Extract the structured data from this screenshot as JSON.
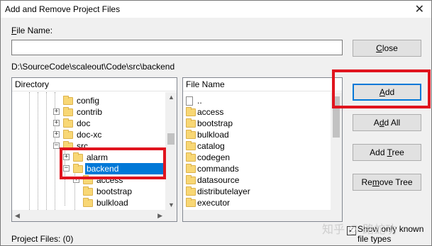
{
  "window": {
    "title": "Add and Remove Project Files",
    "close_glyph": "✕"
  },
  "file_name_label": "File Name:",
  "file_name_value": "",
  "current_path": "D:\\SourceCode\\scaleout\\Code\\src\\backend",
  "directory": {
    "header": "Directory",
    "items": [
      {
        "label": "config",
        "expander": ""
      },
      {
        "label": "contrib",
        "expander": "+"
      },
      {
        "label": "doc",
        "expander": "+"
      },
      {
        "label": "doc-xc",
        "expander": "+"
      },
      {
        "label": "src",
        "expander": "−"
      },
      {
        "label": "alarm",
        "expander": "+"
      },
      {
        "label": "backend",
        "expander": "−",
        "selected": true
      },
      {
        "label": "access",
        "expander": "+"
      },
      {
        "label": "bootstrap",
        "expander": ""
      },
      {
        "label": "bulkload",
        "expander": ""
      }
    ]
  },
  "files": {
    "header": "File Name",
    "items": [
      "..",
      "access",
      "bootstrap",
      "bulkload",
      "catalog",
      "codegen",
      "commands",
      "datasource",
      "distributelayer",
      "executor"
    ]
  },
  "buttons": {
    "close": {
      "label": "Close",
      "mnemonic": "C"
    },
    "add": {
      "label": "Add",
      "mnemonic": "A"
    },
    "add_all": {
      "label": "Add All",
      "mnemonic": "d"
    },
    "add_tree": {
      "label": "Add Tree",
      "mnemonic": "T"
    },
    "remove_tree": {
      "label": "Remove Tree",
      "mnemonic": "m"
    }
  },
  "project_files_label": "Project Files: (0)",
  "show_only_known": {
    "label_line1": "Show only known",
    "label_line2": "file types",
    "checked": true,
    "check_glyph": "✓"
  },
  "watermark": "知乎 @ 路蛇功",
  "colors": {
    "highlight_red": "#e0141e",
    "selection_blue": "#0078d7",
    "folder_yellow": "#f8d775"
  }
}
